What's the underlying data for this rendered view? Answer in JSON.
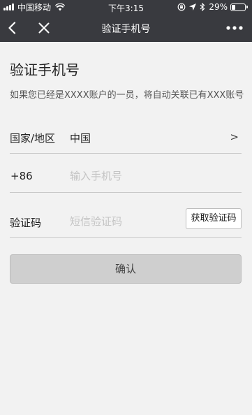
{
  "status_bar": {
    "carrier": "中国移动",
    "time": "下午3:15",
    "battery_percent": "29%",
    "battery_level": 0.29,
    "icons": [
      "signal-icon",
      "wifi-icon",
      "lock-rotation-icon",
      "location-icon",
      "bluetooth-icon",
      "battery-icon"
    ]
  },
  "nav": {
    "title": "验证手机号",
    "icons": [
      "back-icon",
      "close-icon",
      "more-icon"
    ]
  },
  "page": {
    "title": "验证手机号",
    "description": "如果您已经是XXXX账户的一员，将自动关联已有XXX账号"
  },
  "form": {
    "region": {
      "label": "国家/地区",
      "value": "中国",
      "arrow": ">"
    },
    "phone": {
      "prefix": "+86",
      "placeholder": "输入手机号",
      "value": ""
    },
    "code": {
      "label": "验证码",
      "placeholder": "短信验证码",
      "value": "",
      "get_code_label": "获取验证码"
    },
    "confirm_label": "确认"
  },
  "colors": {
    "nav_background": "#393a3f",
    "page_background": "#f2f2f2",
    "confirm_disabled": "#cfcfcf"
  }
}
